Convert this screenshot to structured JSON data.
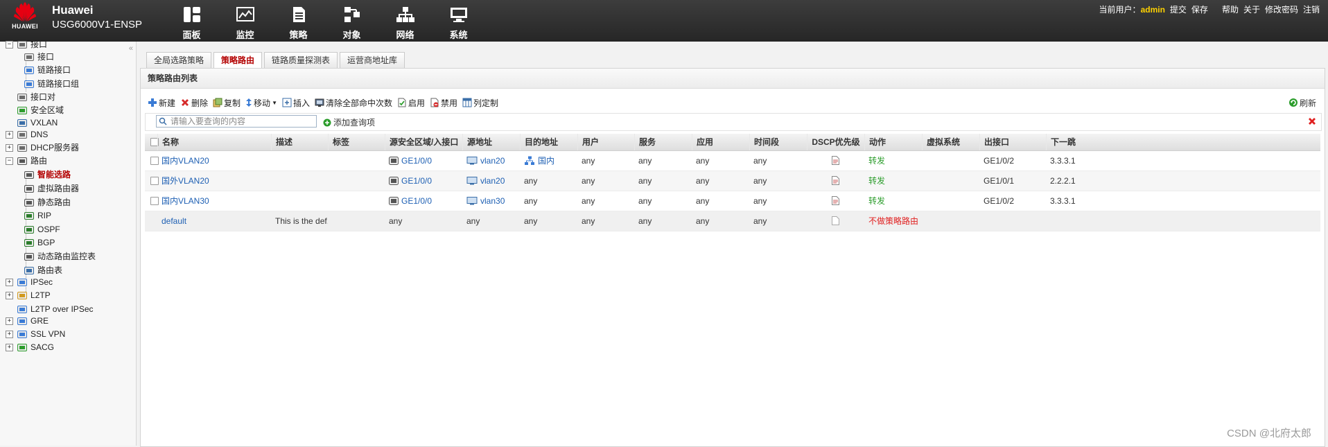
{
  "header": {
    "logo_text": "HUAWEI",
    "brand_title": "Huawei",
    "device_name": "USG6000V1-ENSP",
    "nav": [
      {
        "label": "面板",
        "icon": "dashboard-icon"
      },
      {
        "label": "监控",
        "icon": "monitor-icon"
      },
      {
        "label": "策略",
        "icon": "policy-icon"
      },
      {
        "label": "对象",
        "icon": "object-icon"
      },
      {
        "label": "网络",
        "icon": "network-icon"
      },
      {
        "label": "系统",
        "icon": "system-icon"
      }
    ],
    "current_user_label": "当前用户：",
    "current_user": "admin",
    "links": {
      "submit": "提交",
      "save": "保存",
      "help": "帮助",
      "about": "关于",
      "change_password": "修改密码",
      "logout": "注销"
    }
  },
  "sidebar": {
    "collapse": "«",
    "items": [
      {
        "label": "接口",
        "icon": "interface-icon",
        "toggle": "−"
      },
      {
        "label": "接口",
        "icon": "interface-icon"
      },
      {
        "label": "链路接口",
        "icon": "link-interface-icon"
      },
      {
        "label": "链路接口组",
        "icon": "link-interface-group-icon"
      },
      {
        "label": "接口对",
        "icon": "interface-pair-icon"
      },
      {
        "label": "安全区域",
        "icon": "security-zone-icon"
      },
      {
        "label": "VXLAN",
        "icon": "vxlan-icon"
      },
      {
        "label": "DNS",
        "icon": "dns-icon",
        "toggle": "+"
      },
      {
        "label": "DHCP服务器",
        "icon": "dhcp-icon",
        "toggle": "+"
      },
      {
        "label": "路由",
        "icon": "router-icon",
        "toggle": "−"
      },
      {
        "label": "智能选路",
        "icon": "smart-routing-icon"
      },
      {
        "label": "虚拟路由器",
        "icon": "virtual-router-icon"
      },
      {
        "label": "静态路由",
        "icon": "static-route-icon"
      },
      {
        "label": "RIP",
        "icon": "rip-icon"
      },
      {
        "label": "OSPF",
        "icon": "ospf-icon"
      },
      {
        "label": "BGP",
        "icon": "bgp-icon"
      },
      {
        "label": "动态路由监控表",
        "icon": "route-monitor-icon"
      },
      {
        "label": "路由表",
        "icon": "route-table-icon"
      },
      {
        "label": "IPSec",
        "icon": "ipsec-icon",
        "toggle": "+"
      },
      {
        "label": "L2TP",
        "icon": "l2tp-icon",
        "toggle": "+"
      },
      {
        "label": "L2TP over IPSec",
        "icon": "l2tp-ipsec-icon"
      },
      {
        "label": "GRE",
        "icon": "gre-icon",
        "toggle": "+"
      },
      {
        "label": "SSL VPN",
        "icon": "ssl-vpn-icon",
        "toggle": "+"
      },
      {
        "label": "SACG",
        "icon": "sacg-icon",
        "toggle": "+"
      }
    ],
    "selected": "智能选路"
  },
  "main": {
    "tabs": [
      {
        "label": "全局选路策略"
      },
      {
        "label": "策略路由"
      },
      {
        "label": "链路质量探测表"
      },
      {
        "label": "运营商地址库"
      }
    ],
    "active_tab": "策略路由",
    "panel_title": "策略路由列表",
    "toolbar": {
      "new": "新建",
      "delete": "删除",
      "copy": "复制",
      "move": "移动",
      "insert": "插入",
      "clear_hits": "清除全部命中次数",
      "enable": "启用",
      "disable": "禁用",
      "customize_columns": "列定制",
      "refresh": "刷新"
    },
    "search": {
      "placeholder": "请输入要查询的内容",
      "add_query": "添加查询项"
    },
    "columns": [
      "名称",
      "描述",
      "标签",
      "源安全区域/入接口",
      "源地址",
      "目的地址",
      "用户",
      "服务",
      "应用",
      "时间段",
      "DSCP优先级",
      "动作",
      "虚拟系统",
      "出接口",
      "下一跳"
    ],
    "rows": [
      {
        "name": "国内VLAN20",
        "desc": "",
        "tag": "",
        "src_if": "GE1/0/0",
        "src_addr": "vlan20",
        "dst_addr": "国内",
        "user": "any",
        "service": "any",
        "app": "any",
        "time": "any",
        "action": "转发",
        "vsys": "",
        "out_if": "GE1/0/2",
        "next_hop": "3.3.3.1"
      },
      {
        "name": "国外VLAN20",
        "desc": "",
        "tag": "",
        "src_if": "GE1/0/0",
        "src_addr": "vlan20",
        "dst_addr": "any",
        "user": "any",
        "service": "any",
        "app": "any",
        "time": "any",
        "action": "转发",
        "vsys": "",
        "out_if": "GE1/0/1",
        "next_hop": "2.2.2.1"
      },
      {
        "name": "国内VLAN30",
        "desc": "",
        "tag": "",
        "src_if": "GE1/0/0",
        "src_addr": "vlan30",
        "dst_addr": "any",
        "user": "any",
        "service": "any",
        "app": "any",
        "time": "any",
        "action": "转发",
        "vsys": "",
        "out_if": "GE1/0/2",
        "next_hop": "3.3.3.1"
      },
      {
        "name": "default",
        "desc": "This is the def...",
        "tag": "",
        "src_if": "any",
        "src_addr": "any",
        "dst_addr": "any",
        "user": "any",
        "service": "any",
        "app": "any",
        "time": "any",
        "action": "不做策略路由",
        "vsys": "",
        "out_if": "",
        "next_hop": ""
      }
    ]
  },
  "watermark": "CSDN @北府太郎",
  "colors": {
    "accent_red": "#b30000",
    "link_blue": "#1d5fb3",
    "forward_green": "#2c9d2c",
    "no_route_red": "#e02020",
    "user_yellow": "#ffd200"
  }
}
